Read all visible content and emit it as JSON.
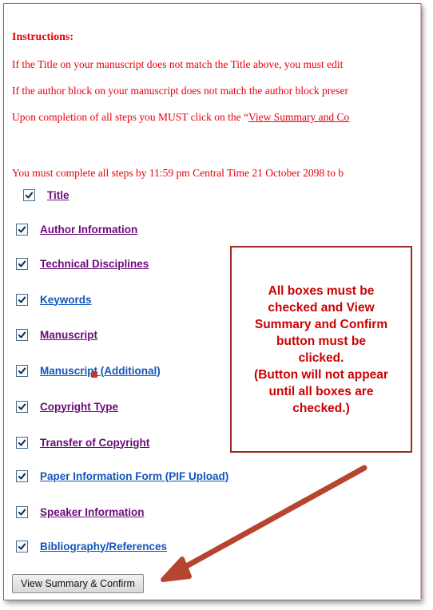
{
  "instructions": {
    "title": "Instructions:",
    "line1": "If the Title on your manuscript does not match the Title above, you must edit",
    "line2": "If the author block on your manuscript does not match the author block preser",
    "line3_prefix": "Upon completion of all steps you MUST click on the “",
    "line3_link": "View Summary and Co",
    "deadline": "You must complete all steps by 11:59 pm Central Time 21 October 2098 to b"
  },
  "steps": [
    {
      "label": "Title",
      "checked": true,
      "color": "purple"
    },
    {
      "label": "Author Information",
      "checked": true,
      "color": "purple"
    },
    {
      "label": "Technical Disciplines",
      "checked": true,
      "color": "purple"
    },
    {
      "label": "Keywords",
      "checked": true,
      "color": "blue"
    },
    {
      "label": "Manuscript",
      "checked": true,
      "color": "purple"
    },
    {
      "label": "Manuscript (Additional)",
      "checked": true,
      "color": "blue"
    },
    {
      "label": "Copyright Type",
      "checked": true,
      "color": "purple"
    },
    {
      "label": "Transfer of Copyright",
      "checked": true,
      "color": "purple"
    },
    {
      "label": "Paper Information Form (PIF Upload)",
      "checked": true,
      "color": "blue"
    },
    {
      "label": "Speaker Information",
      "checked": true,
      "color": "purple"
    },
    {
      "label": "Bibliography/References",
      "checked": true,
      "color": "blue"
    }
  ],
  "callout": {
    "text": "All boxes must be\nchecked and View\nSummary and Confirm\nbutton must be\nclicked.\n(Button will not appear\nuntil all boxes are\nchecked.)"
  },
  "button": {
    "label": "View Summary & Confirm"
  },
  "colors": {
    "instructions": "#e8000b",
    "link_purple": "#6b0a7a",
    "link_blue": "#1155bb",
    "callout_border": "#9b2c20",
    "callout_text": "#cc0000",
    "arrow": "#b5452f"
  }
}
